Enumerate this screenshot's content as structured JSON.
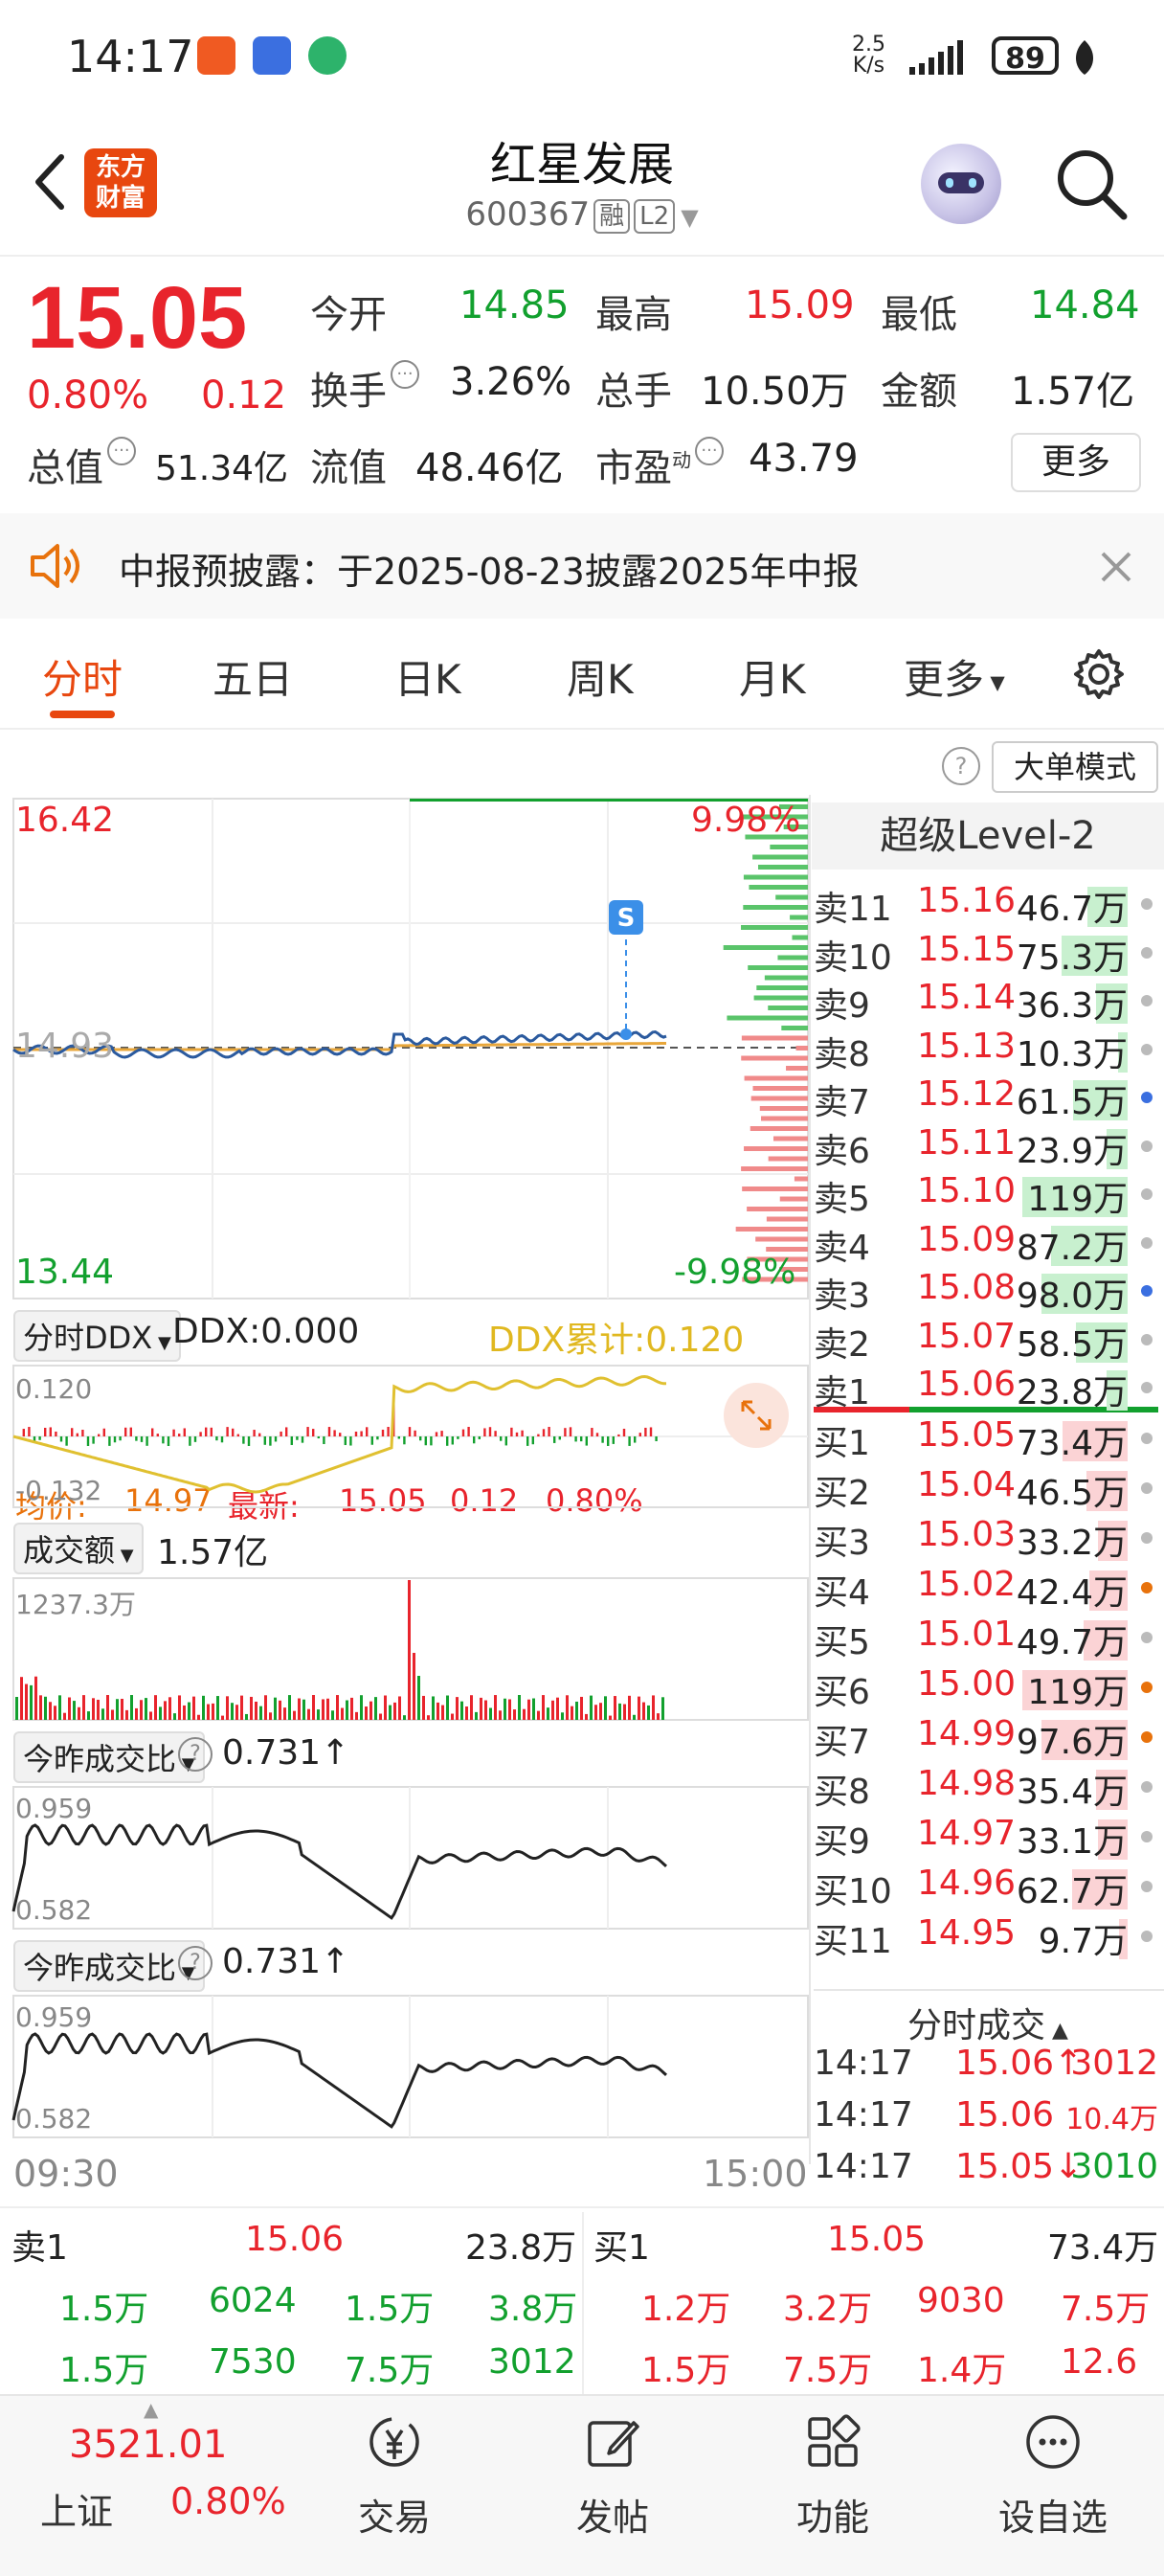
{
  "status_bar": {
    "time": "14:17",
    "net_speed_top": "2.5",
    "net_speed_unit": "K/s",
    "battery": "89"
  },
  "header": {
    "logo_line1": "东方",
    "logo_line2": "财富",
    "name": "红星发展",
    "code": "600367",
    "tag1": "融",
    "tag2": "L2"
  },
  "quote": {
    "price": "15.05",
    "pct": "0.80%",
    "change": "0.12",
    "open_label": "今开",
    "open": "14.85",
    "high_label": "最高",
    "high": "15.09",
    "low_label": "最低",
    "low": "14.84",
    "turnover_label": "换手",
    "turnover": "3.26%",
    "volume_label": "总手",
    "volume": "10.50万",
    "amount_label": "金额",
    "amount": "1.57亿",
    "mcap_label": "总值",
    "mcap": "51.34亿",
    "float_label": "流值",
    "float": "48.46亿",
    "pe_label": "市盈",
    "pe_sup": "动",
    "pe": "43.79",
    "more": "更多"
  },
  "notice": {
    "text": "中报预披露：于2025-08-23披露2025年中报"
  },
  "tabs": [
    "分时",
    "五日",
    "日K",
    "周K",
    "月K",
    "更多"
  ],
  "avg_bar": {
    "avg_label": "均价:",
    "avg": "14.97",
    "latest_label": "最新:",
    "latest": "15.05",
    "chg": "0.12",
    "pct": "0.80%",
    "big_order": "大单模式"
  },
  "intraday": {
    "top_price": "16.42",
    "bottom_price": "13.44",
    "top_pct": "9.98%",
    "bottom_pct": "-9.98%",
    "ref_price": "14.93",
    "marker": "S",
    "time_start": "09:30",
    "time_end": "15:00"
  },
  "ddx": {
    "selector": "分时DDX",
    "value": "DDX:0.000",
    "cum": "DDX累计:0.120",
    "top": "0.120",
    "bottom": "-0.132"
  },
  "volume_panel": {
    "selector": "成交额",
    "value": "1.57亿",
    "max": "1237.3万"
  },
  "ratio_panel1": {
    "selector": "今昨成交比",
    "value": "0.731",
    "top": "0.959",
    "bottom": "0.582"
  },
  "ratio_panel2": {
    "selector": "今昨成交比",
    "value": "0.731",
    "top": "0.959",
    "bottom": "0.582"
  },
  "level2": {
    "title": "超级Level-2",
    "asks": [
      {
        "label": "卖11",
        "price": "15.16",
        "vol": "46.7万",
        "fill": 0.38
      },
      {
        "label": "卖10",
        "price": "15.15",
        "vol": "75.3万",
        "fill": 0.63
      },
      {
        "label": "卖9",
        "price": "15.14",
        "vol": "36.3万",
        "fill": 0.3
      },
      {
        "label": "卖8",
        "price": "15.13",
        "vol": "10.3万",
        "fill": 0.09
      },
      {
        "label": "卖7",
        "price": "15.12",
        "vol": "61.5万",
        "fill": 0.52
      },
      {
        "label": "卖6",
        "price": "15.11",
        "vol": "23.9万",
        "fill": 0.2
      },
      {
        "label": "卖5",
        "price": "15.10",
        "vol": "119万",
        "fill": 1.0
      },
      {
        "label": "卖4",
        "price": "15.09",
        "vol": "87.2万",
        "fill": 0.73
      },
      {
        "label": "卖3",
        "price": "15.08",
        "vol": "98.0万",
        "fill": 0.82
      },
      {
        "label": "卖2",
        "price": "15.07",
        "vol": "58.5万",
        "fill": 0.49
      },
      {
        "label": "卖1",
        "price": "15.06",
        "vol": "23.8万",
        "fill": 0.2
      }
    ],
    "bids": [
      {
        "label": "买1",
        "price": "15.05",
        "vol": "73.4万",
        "fill": 0.62
      },
      {
        "label": "买2",
        "price": "15.04",
        "vol": "46.5万",
        "fill": 0.39
      },
      {
        "label": "买3",
        "price": "15.03",
        "vol": "33.2万",
        "fill": 0.28
      },
      {
        "label": "买4",
        "price": "15.02",
        "vol": "42.4万",
        "fill": 0.36
      },
      {
        "label": "买5",
        "price": "15.01",
        "vol": "49.7万",
        "fill": 0.42
      },
      {
        "label": "买6",
        "price": "15.00",
        "vol": "119万",
        "fill": 1.0
      },
      {
        "label": "买7",
        "price": "14.99",
        "vol": "97.6万",
        "fill": 0.82
      },
      {
        "label": "买8",
        "price": "14.98",
        "vol": "35.4万",
        "fill": 0.3
      },
      {
        "label": "买9",
        "price": "14.97",
        "vol": "33.1万",
        "fill": 0.28
      },
      {
        "label": "买10",
        "price": "14.96",
        "vol": "62.7万",
        "fill": 0.53
      },
      {
        "label": "买11",
        "price": "14.95",
        "vol": "9.7万",
        "fill": 0.08
      }
    ]
  },
  "ticks": {
    "title": "分时成交",
    "rows": [
      {
        "time": "14:17",
        "price": "15.06",
        "arrow": "↑",
        "vol": "3012"
      },
      {
        "time": "14:17",
        "price": "15.06",
        "arrow": "",
        "vol": "10.4万"
      },
      {
        "time": "14:17",
        "price": "15.05",
        "arrow": "↓",
        "vol": "3010"
      }
    ]
  },
  "book": {
    "ask_label": "卖1",
    "ask_price": "15.06",
    "ask_vol": "23.8万",
    "bid_label": "买1",
    "bid_price": "15.05",
    "bid_vol": "73.4万",
    "ask_row1": [
      "1.5万",
      "6024",
      "1.5万",
      "3.8万"
    ],
    "ask_row2": [
      "1.5万",
      "7530",
      "7.5万",
      "3012"
    ],
    "bid_row1": [
      "1.2万",
      "3.2万",
      "9030",
      "7.5万"
    ],
    "bid_row2": [
      "1.5万",
      "7.5万",
      "1.4万",
      "12.6万"
    ]
  },
  "bottom_nav": {
    "index_value": "3521.01",
    "index_name": "上证",
    "index_pct": "0.80%",
    "items": [
      "交易",
      "发帖",
      "功能",
      "设自选"
    ]
  }
}
